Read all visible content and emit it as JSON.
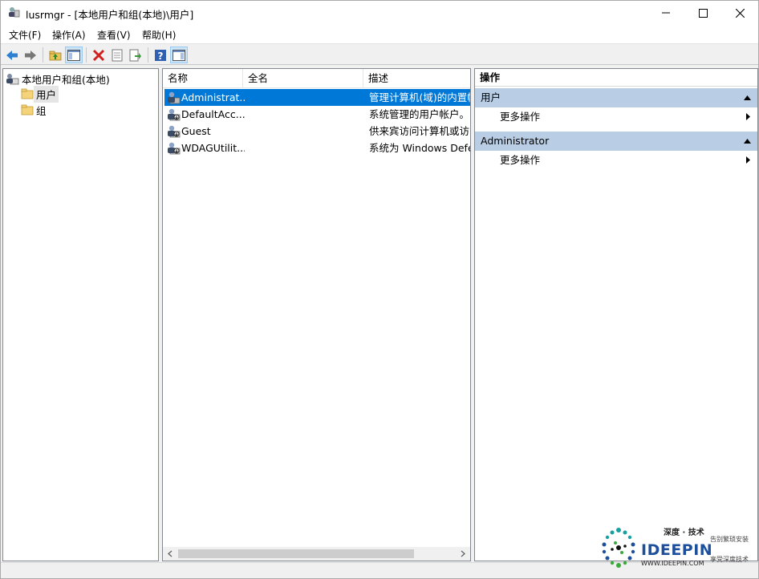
{
  "window": {
    "title": "lusrmgr - [本地用户和组(本地)\\用户]"
  },
  "menu": [
    "文件(F)",
    "操作(A)",
    "查看(V)",
    "帮助(H)"
  ],
  "tree": {
    "root": "本地用户和组(本地)",
    "items": [
      {
        "label": "用户",
        "selected": true
      },
      {
        "label": "组",
        "selected": false
      }
    ]
  },
  "list": {
    "columns": [
      "名称",
      "全名",
      "描述"
    ],
    "rows": [
      {
        "name": "Administrat...",
        "fullname": "",
        "desc": "管理计算机(域)的内置帐",
        "selected": true
      },
      {
        "name": "DefaultAcc...",
        "fullname": "",
        "desc": "系统管理的用户帐户。",
        "selected": false
      },
      {
        "name": "Guest",
        "fullname": "",
        "desc": "供来宾访问计算机或访问",
        "selected": false
      },
      {
        "name": "WDAGUtilit...",
        "fullname": "",
        "desc": "系统为 Windows Defe",
        "selected": false
      }
    ]
  },
  "actions": {
    "title": "操作",
    "groups": [
      {
        "label": "用户",
        "item": "更多操作"
      },
      {
        "label": "Administrator",
        "item": "更多操作"
      }
    ]
  },
  "watermark": {
    "brand": "IDEEPIN",
    "top": "深度 · 技术",
    "url": "WWW.IDEEPIN.COM",
    "right1": "告别繁琐安装",
    "right2": "享受深度技术"
  },
  "colors": {
    "selection": "#0078d7",
    "action_group": "#b9cde5"
  }
}
